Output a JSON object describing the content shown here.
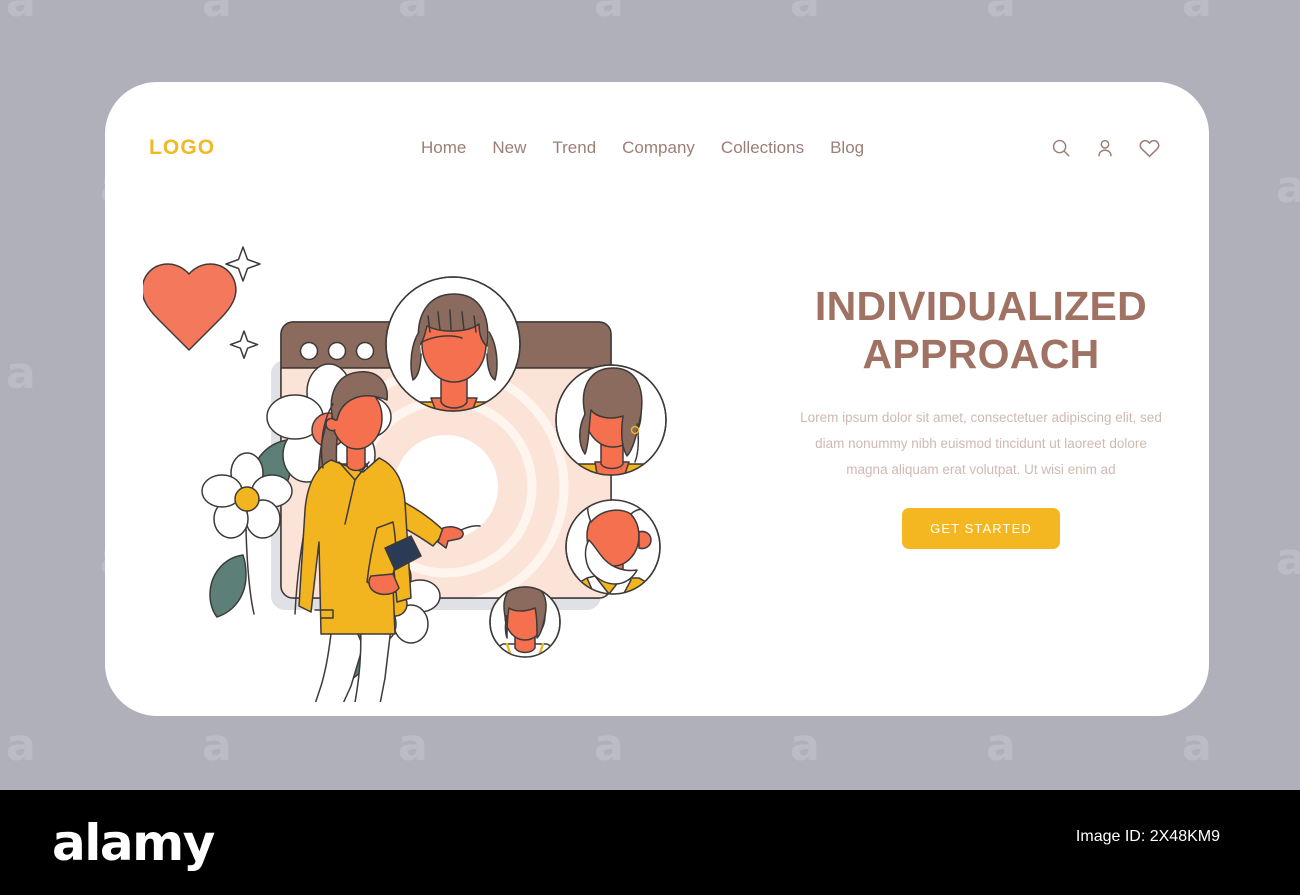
{
  "canvas": {
    "background_color": "#b0b0bb",
    "watermark_letter": "a",
    "card_background": "#ffffff"
  },
  "header": {
    "logo": "LOGO",
    "logo_color": "#f2b825",
    "nav": [
      {
        "label": "Home"
      },
      {
        "label": "New"
      },
      {
        "label": "Trend"
      },
      {
        "label": "Company"
      },
      {
        "label": "Collections"
      },
      {
        "label": "Blog"
      }
    ],
    "nav_color": "#9b7f76",
    "icons": [
      {
        "name": "search-icon"
      },
      {
        "name": "user-icon"
      },
      {
        "name": "heart-icon"
      }
    ]
  },
  "hero": {
    "headline_line1": "INDIVIDUALIZED",
    "headline_line2": "APPROACH",
    "headline_color": "#a07264",
    "body": "Lorem ipsum dolor sit amet, consectetuer adipiscing elit, sed diam nonummy nibh euismod tincidunt ut laoreet dolore magna aliquam erat volutpat. Ut wisi enim ad",
    "body_color": "#cfb9b2",
    "cta_label": "GET STARTED",
    "cta_color": "#f4b721",
    "cta_text_color": "#ffffff"
  },
  "illustration": {
    "name": "individualized-approach-illustration",
    "description": "Woman in a yellow coat holding a phone and pointing at a browser window mockup surrounded by circular user avatars, a heart, sparkles and daisy flowers",
    "palette": {
      "skin": "#f4704f",
      "coral": "#f4785c",
      "hair_brown": "#8a6b5d",
      "yellow": "#f2b51f",
      "mustard": "#edb52a",
      "screen_pink": "#fbe3d8",
      "leaf_green": "#5c8078",
      "outline": "#3e3a39",
      "white": "#ffffff",
      "phone_navy": "#2b3a55",
      "gray_frame": "#dadce0"
    },
    "browser_dots": 3,
    "avatars": [
      {
        "name": "avatar-woman-bob-haircut"
      },
      {
        "name": "avatar-woman-curly-hair"
      },
      {
        "name": "avatar-older-man"
      },
      {
        "name": "avatar-young-woman"
      }
    ],
    "decorations": [
      {
        "name": "heart-shape"
      },
      {
        "name": "sparkle-large"
      },
      {
        "name": "sparkle-small"
      },
      {
        "name": "daisy-flower-coral-center"
      },
      {
        "name": "daisy-flower-yellow-center"
      },
      {
        "name": "daisy-flower-small-yellow-center"
      }
    ]
  },
  "footer": {
    "brand": "alamy",
    "image_id": "Image ID: 2X48KM9",
    "background_color": "#000000"
  }
}
